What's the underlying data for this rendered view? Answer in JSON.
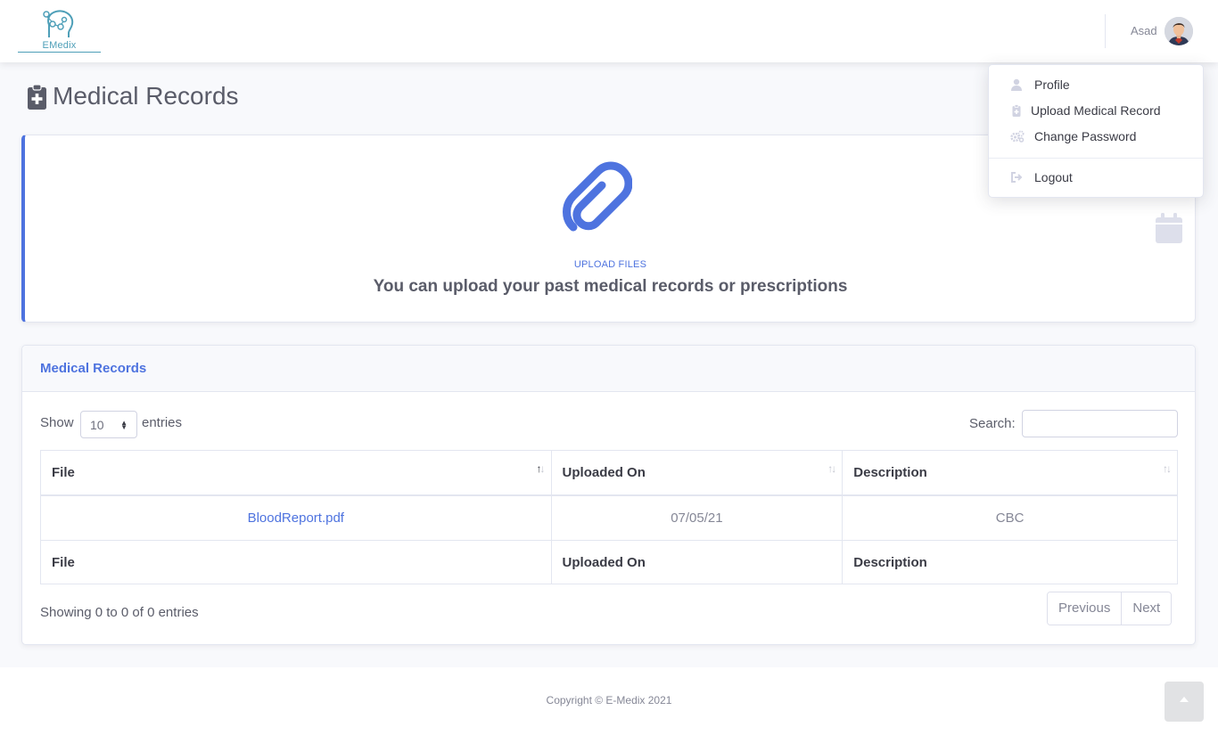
{
  "brand": {
    "name": "E-Medix",
    "logo_text": "EMedix"
  },
  "user": {
    "name": "Asad"
  },
  "user_menu": {
    "items": [
      {
        "label": "Profile",
        "icon": "user-icon"
      },
      {
        "label": "Upload Medical Record",
        "icon": "clipboard-icon"
      },
      {
        "label": "Change Password",
        "icon": "cogs-icon"
      }
    ],
    "logout": {
      "label": "Logout",
      "icon": "sign-out-icon"
    }
  },
  "page": {
    "title": "Medical Records",
    "icon": "clipboard-medical-icon"
  },
  "upload": {
    "label": "UPLOAD FILES",
    "text": "You can upload your past medical records or prescriptions",
    "icon": "paperclip-icon",
    "side_icon": "calendar-icon"
  },
  "records": {
    "title": "Medical Records",
    "show_label": "Show",
    "entries_value": "10",
    "entries_label": "entries",
    "search_label": "Search:",
    "search_value": "",
    "columns": [
      "File",
      "Uploaded On",
      "Description"
    ],
    "rows": [
      {
        "file": "BloodReport.pdf",
        "uploaded_on": "07/05/21",
        "description": "CBC"
      }
    ],
    "info": "Showing 0 to 0 of 0 entries",
    "pagination": {
      "previous": "Previous",
      "next": "Next"
    }
  },
  "footer": {
    "copyright": "Copyright © E-Medix 2021"
  },
  "colors": {
    "primary": "#4e73df",
    "text_dark": "#5a5c69",
    "text_muted": "#858796",
    "page_bg": "#f8f9fc"
  }
}
